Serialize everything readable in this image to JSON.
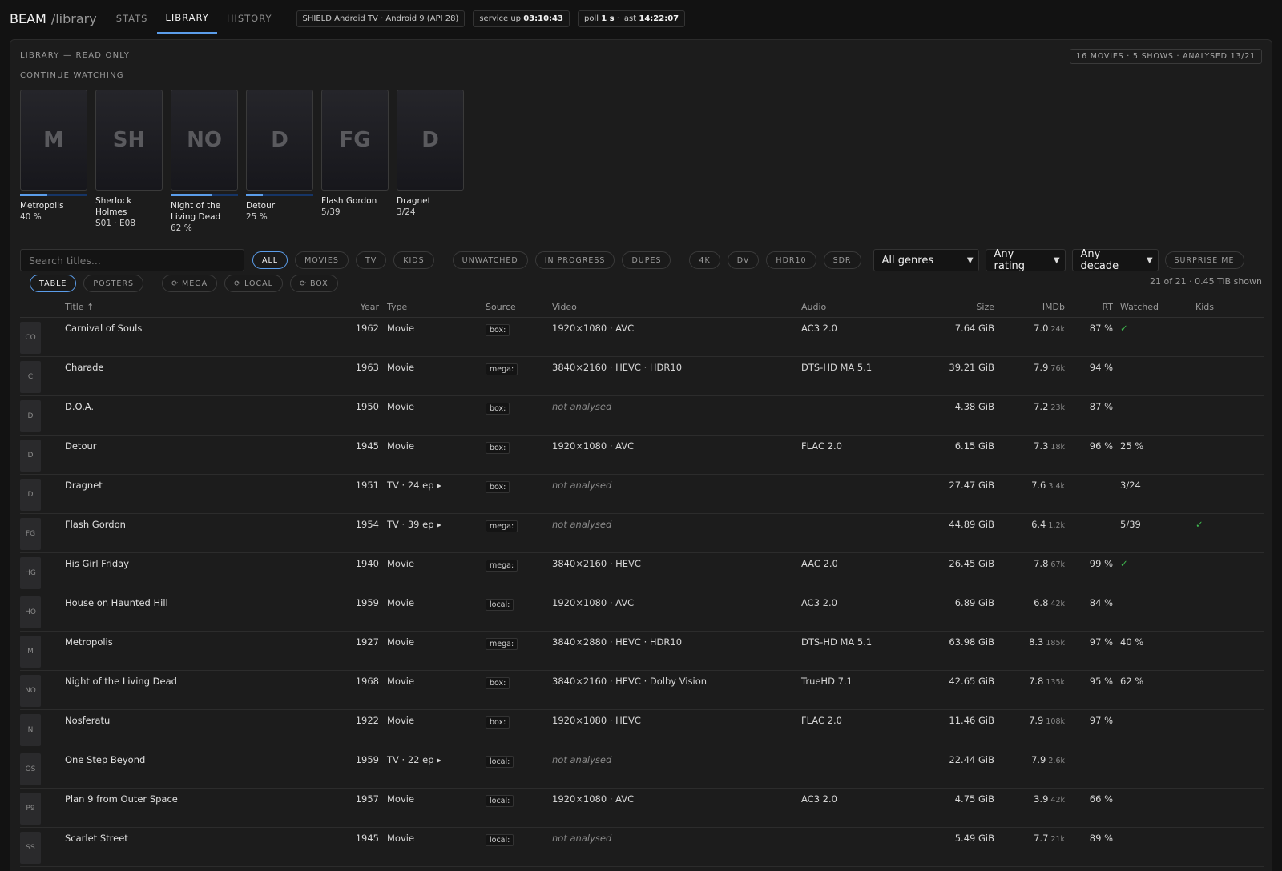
{
  "brand": {
    "name": "BEAM",
    "path": "/library"
  },
  "nav_tabs": [
    {
      "label": "STATS"
    },
    {
      "label": "LIBRARY"
    },
    {
      "label": "HISTORY"
    }
  ],
  "status": {
    "device": "SHIELD Android TV · Android 9 (API 28)",
    "uptime_label": "service up",
    "uptime_value": "03:10:43",
    "poll_label": "poll",
    "poll_value": "1 s",
    "last_label": "· last",
    "last_value": "14:22:07"
  },
  "library": {
    "heading": "LIBRARY — READ ONLY",
    "summary": "16 MOVIES · 5 SHOWS · ANALYSED 13/21",
    "continue_heading": "CONTINUE WATCHING"
  },
  "continue_watching": [
    {
      "initials": "M",
      "title": "Metropolis",
      "sub": "40 %",
      "progress": 0.4
    },
    {
      "initials": "SH",
      "title": "Sherlock Holmes",
      "sub": "S01 · E08",
      "progress": null
    },
    {
      "initials": "NO",
      "title": "Night of the Living Dead",
      "sub": "62 %",
      "progress": 0.62
    },
    {
      "initials": "D",
      "title": "Detour",
      "sub": "25 %",
      "progress": 0.25
    },
    {
      "initials": "FG",
      "title": "Flash Gordon",
      "sub": "5/39",
      "progress": null
    },
    {
      "initials": "D",
      "title": "Dragnet",
      "sub": "3/24",
      "progress": null
    }
  ],
  "filters": {
    "search_placeholder": "Search titles...",
    "type_chips": [
      "ALL",
      "MOVIES",
      "TV",
      "KIDS"
    ],
    "state_chips": [
      "UNWATCHED",
      "IN PROGRESS",
      "DUPES"
    ],
    "format_chips": [
      "4K",
      "DV",
      "HDR10",
      "SDR"
    ],
    "genre": "All genres",
    "rating": "Any rating",
    "decade": "Any decade",
    "surprise": "SURPRISE ME"
  },
  "view": {
    "table": "TABLE",
    "posters": "POSTERS",
    "refresh": [
      "⟳ MEGA",
      "⟳ LOCAL",
      "⟳ BOX"
    ],
    "shown": "21 of 21 · 0.45 TiB shown"
  },
  "columns": {
    "title": "Title ↑",
    "year": "Year",
    "type": "Type",
    "source": "Source",
    "video": "Video",
    "audio": "Audio",
    "size": "Size",
    "imdb": "IMDb",
    "rt": "RT",
    "watched": "Watched",
    "kids": "Kids"
  },
  "rows": [
    {
      "initials": "CO",
      "title": "Carnival of Souls",
      "year": "1962",
      "type": "Movie",
      "source": "box:",
      "video": "1920×1080 · AVC",
      "video_na": false,
      "audio": "AC3 2.0",
      "size": "7.64 GiB",
      "imdb": "7.0",
      "votes": "24k",
      "rt": "87 %",
      "watched": "✓",
      "kids": ""
    },
    {
      "initials": "C",
      "title": "Charade",
      "year": "1963",
      "type": "Movie",
      "source": "mega:",
      "video": "3840×2160 · HEVC · HDR10",
      "video_na": false,
      "audio": "DTS-HD MA 5.1",
      "size": "39.21 GiB",
      "imdb": "7.9",
      "votes": "76k",
      "rt": "94 %",
      "watched": "",
      "kids": ""
    },
    {
      "initials": "D",
      "title": "D.O.A.",
      "year": "1950",
      "type": "Movie",
      "source": "box:",
      "video": "not analysed",
      "video_na": true,
      "audio": "",
      "size": "4.38 GiB",
      "imdb": "7.2",
      "votes": "23k",
      "rt": "87 %",
      "watched": "",
      "kids": ""
    },
    {
      "initials": "D",
      "title": "Detour",
      "year": "1945",
      "type": "Movie",
      "source": "box:",
      "video": "1920×1080 · AVC",
      "video_na": false,
      "audio": "FLAC 2.0",
      "size": "6.15 GiB",
      "imdb": "7.3",
      "votes": "18k",
      "rt": "96 %",
      "watched": "25 %",
      "kids": ""
    },
    {
      "initials": "D",
      "title": "Dragnet",
      "year": "1951",
      "type": "TV · 24 ep ▸",
      "source": "box:",
      "video": "not analysed",
      "video_na": true,
      "audio": "",
      "size": "27.47 GiB",
      "imdb": "7.6",
      "votes": "3.4k",
      "rt": "",
      "watched": "3/24",
      "kids": ""
    },
    {
      "initials": "FG",
      "title": "Flash Gordon",
      "year": "1954",
      "type": "TV · 39 ep ▸",
      "source": "mega:",
      "video": "not analysed",
      "video_na": true,
      "audio": "",
      "size": "44.89 GiB",
      "imdb": "6.4",
      "votes": "1.2k",
      "rt": "",
      "watched": "5/39",
      "kids": "✓"
    },
    {
      "initials": "HG",
      "title": "His Girl Friday",
      "year": "1940",
      "type": "Movie",
      "source": "mega:",
      "video": "3840×2160 · HEVC",
      "video_na": false,
      "audio": "AAC 2.0",
      "size": "26.45 GiB",
      "imdb": "7.8",
      "votes": "67k",
      "rt": "99 %",
      "watched": "✓",
      "kids": ""
    },
    {
      "initials": "HO",
      "title": "House on Haunted Hill",
      "year": "1959",
      "type": "Movie",
      "source": "local:",
      "video": "1920×1080 · AVC",
      "video_na": false,
      "audio": "AC3 2.0",
      "size": "6.89 GiB",
      "imdb": "6.8",
      "votes": "42k",
      "rt": "84 %",
      "watched": "",
      "kids": ""
    },
    {
      "initials": "M",
      "title": "Metropolis",
      "year": "1927",
      "type": "Movie",
      "source": "mega:",
      "video": "3840×2880 · HEVC · HDR10",
      "video_na": false,
      "audio": "DTS-HD MA 5.1",
      "size": "63.98 GiB",
      "imdb": "8.3",
      "votes": "185k",
      "rt": "97 %",
      "watched": "40 %",
      "kids": ""
    },
    {
      "initials": "NO",
      "title": "Night of the Living Dead",
      "year": "1968",
      "type": "Movie",
      "source": "box:",
      "video": "3840×2160 · HEVC · Dolby Vision",
      "video_na": false,
      "audio": "TrueHD 7.1",
      "size": "42.65 GiB",
      "imdb": "7.8",
      "votes": "135k",
      "rt": "95 %",
      "watched": "62 %",
      "kids": ""
    },
    {
      "initials": "N",
      "title": "Nosferatu",
      "year": "1922",
      "type": "Movie",
      "source": "box:",
      "video": "1920×1080 · HEVC",
      "video_na": false,
      "audio": "FLAC 2.0",
      "size": "11.46 GiB",
      "imdb": "7.9",
      "votes": "108k",
      "rt": "97 %",
      "watched": "",
      "kids": ""
    },
    {
      "initials": "OS",
      "title": "One Step Beyond",
      "year": "1959",
      "type": "TV · 22 ep ▸",
      "source": "local:",
      "video": "not analysed",
      "video_na": true,
      "audio": "",
      "size": "22.44 GiB",
      "imdb": "7.9",
      "votes": "2.6k",
      "rt": "",
      "watched": "",
      "kids": ""
    },
    {
      "initials": "P9",
      "title": "Plan 9 from Outer Space",
      "year": "1957",
      "type": "Movie",
      "source": "local:",
      "video": "1920×1080 · AVC",
      "video_na": false,
      "audio": "AC3 2.0",
      "size": "4.75 GiB",
      "imdb": "3.9",
      "votes": "42k",
      "rt": "66 %",
      "watched": "",
      "kids": ""
    },
    {
      "initials": "SS",
      "title": "Scarlet Street",
      "year": "1945",
      "type": "Movie",
      "source": "local:",
      "video": "not analysed",
      "video_na": true,
      "audio": "",
      "size": "5.49 GiB",
      "imdb": "7.7",
      "votes": "21k",
      "rt": "89 %",
      "watched": "",
      "kids": ""
    }
  ],
  "colors": {
    "accent": "#5b9dea",
    "check": "#3fb94f",
    "background": "#121212",
    "panel": "#1c1c1c"
  }
}
